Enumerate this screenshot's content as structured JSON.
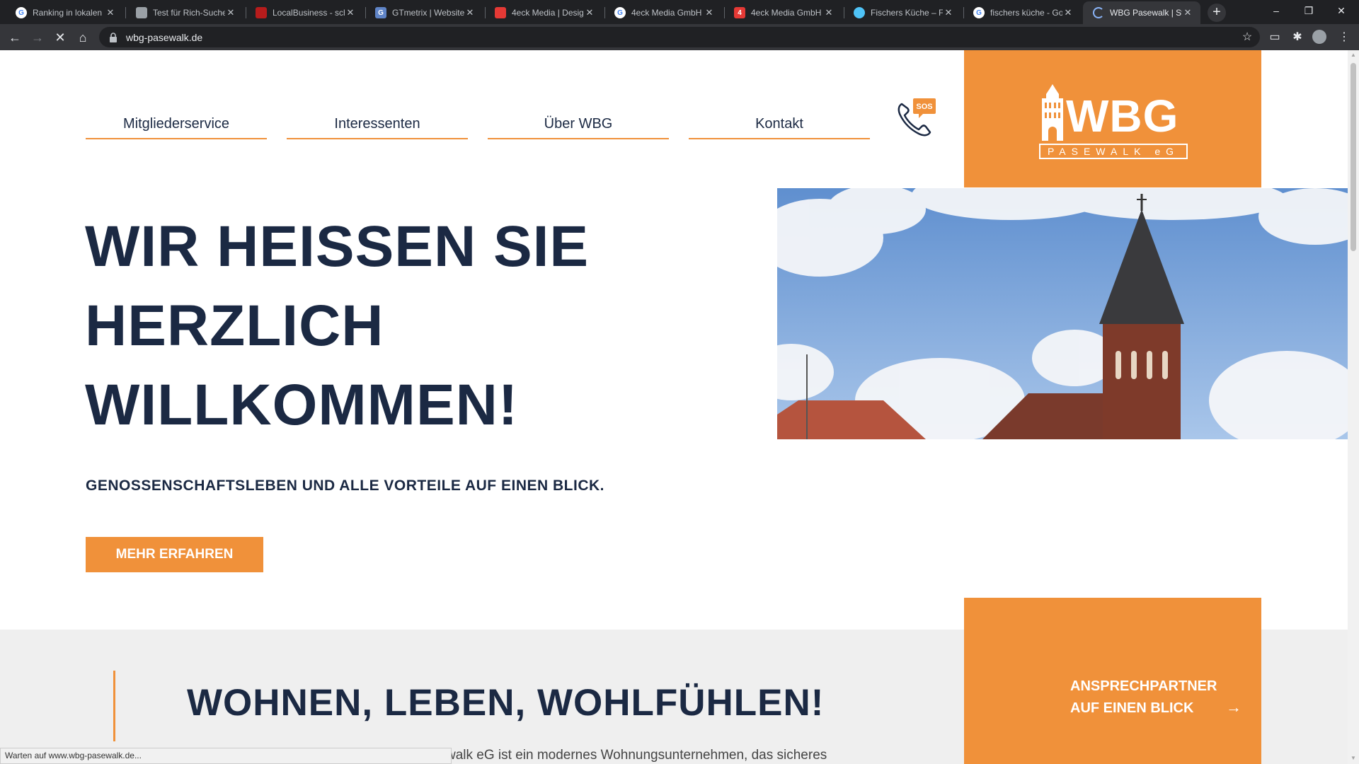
{
  "browser": {
    "tabs": [
      {
        "title": "Ranking in lokalen",
        "favicon": "google-icon",
        "color": "#4285f4"
      },
      {
        "title": "Test für Rich-Suche",
        "favicon": "doc-icon",
        "color": "#9aa0a6"
      },
      {
        "title": "LocalBusiness - sch",
        "favicon": "schema-icon",
        "color": "#b71c1c"
      },
      {
        "title": "GTmetrix | Website",
        "favicon": "gtmetrix-icon",
        "color": "#5f84c7"
      },
      {
        "title": "4eck Media | Desig",
        "favicon": "4eck-icon",
        "color": "#e53935"
      },
      {
        "title": "4eck Media GmbH",
        "favicon": "google-icon",
        "color": "#4285f4"
      },
      {
        "title": "4eck Media GmbH",
        "favicon": "4eck-icon",
        "color": "#e53935"
      },
      {
        "title": "Fischers Küche – Fi",
        "favicon": "globe-icon",
        "color": "#4fc3f7"
      },
      {
        "title": "fischers küche - Go",
        "favicon": "google-icon",
        "color": "#4285f4"
      },
      {
        "title": "WBG Pasewalk | Sta",
        "favicon": "loading-icon",
        "color": "#8ab4f8",
        "active": true
      }
    ],
    "url": "wbg-pasewalk.de",
    "status_text": "Warten auf www.wbg-pasewalk.de..."
  },
  "site": {
    "nav": [
      "Mitgliederservice",
      "Interessenten",
      "Über WBG",
      "Kontakt"
    ],
    "sos_label": "SOS",
    "logo": {
      "word": "WBG",
      "sub": "PASEWALK eG"
    },
    "hero": {
      "title_lines": [
        "WIR HEISSEN SIE",
        "HERZLICH",
        "WILLKOMMEN!"
      ],
      "subtitle": "GENOSSENSCHAFTSLEBEN UND ALLE VORTEILE AUF EINEN BLICK.",
      "button": "MEHR ERFAHREN"
    },
    "section2": {
      "title": "WOHNEN, LEBEN, WOHLFÜHLEN!",
      "text_partial": "walk eG ist ein modernes Wohnungsunternehmen, das sicheres"
    },
    "contact_box": {
      "line1": "ANSPRECHPARTNER",
      "line2": "AUF EINEN BLICK",
      "arrow": "→"
    }
  },
  "colors": {
    "accent": "#f0913a",
    "navy": "#1b2943"
  }
}
